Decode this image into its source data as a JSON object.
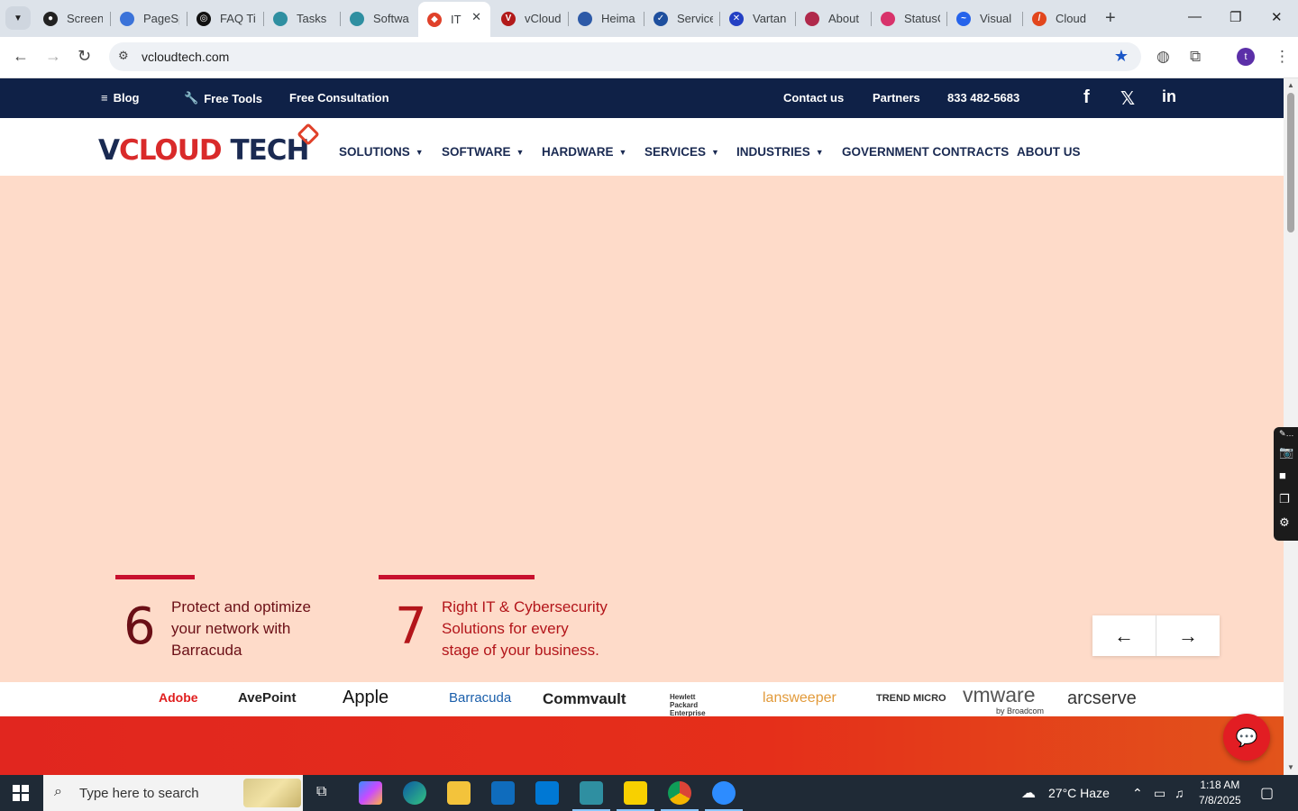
{
  "browser": {
    "tabs": [
      {
        "title": "Screen",
        "color": "#222"
      },
      {
        "title": "PageSp",
        "color": "#3b73d9"
      },
      {
        "title": "FAQ Tit",
        "color": "#111"
      },
      {
        "title": "Tasks",
        "color": "#2f8fa1"
      },
      {
        "title": "Softwa",
        "color": "#2f8fa1"
      },
      {
        "title": "IT",
        "color": "#e0412a"
      },
      {
        "title": "vCloud",
        "color": "#b21a1a"
      },
      {
        "title": "Heima",
        "color": "#2d5aa8"
      },
      {
        "title": "Service",
        "color": "#1e4f9e"
      },
      {
        "title": "Vartan",
        "color": "#2340c4"
      },
      {
        "title": "About",
        "color": "#b0294b"
      },
      {
        "title": "StatusC",
        "color": "#d8336b"
      },
      {
        "title": "Visual",
        "color": "#2563eb"
      },
      {
        "title": "Cloud",
        "color": "#e2461d"
      }
    ],
    "active_tab": "IT",
    "url": "vcloudtech.com"
  },
  "topbar": {
    "blog": "Blog",
    "free_tools": "Free Tools",
    "free_consultation": "Free Consultation",
    "contact": "Contact us",
    "partners": "Partners",
    "phone": "833 482-5683",
    "facebook": "f",
    "x": "𝕏",
    "linkedin": "in"
  },
  "logo": {
    "v": "V",
    "cloud": "CLOUD",
    "tech": " TECH"
  },
  "nav": {
    "solutions": "SOLUTIONS",
    "software": "SOFTWARE",
    "hardware": "HARDWARE",
    "services": "SERVICES",
    "industries": "INDUSTRIES",
    "government": "GOVERNMENT CONTRACTS",
    "about": "ABOUT US"
  },
  "slides": [
    {
      "num": "6",
      "line1": "Protect and optimize",
      "line2": "your network with",
      "line3": "Barracuda"
    },
    {
      "num": "7",
      "line1": "Right IT & Cybersecurity",
      "line2": "Solutions for every",
      "line3": "stage of your business."
    }
  ],
  "arrows": {
    "prev": "←",
    "next": "→"
  },
  "partners": [
    "Adobe",
    "AvePoint",
    "Apple",
    "Barracuda",
    "Commvault",
    "Hewlett Packard Enterprise",
    "lansweeper",
    "TREND MICRO",
    "vmware",
    "by Broadcom",
    "arcserve"
  ],
  "taskbar": {
    "search_placeholder": "Type here to search",
    "weather": "27°C  Haze",
    "time": "1:18 AM",
    "date": "7/8/2025"
  }
}
